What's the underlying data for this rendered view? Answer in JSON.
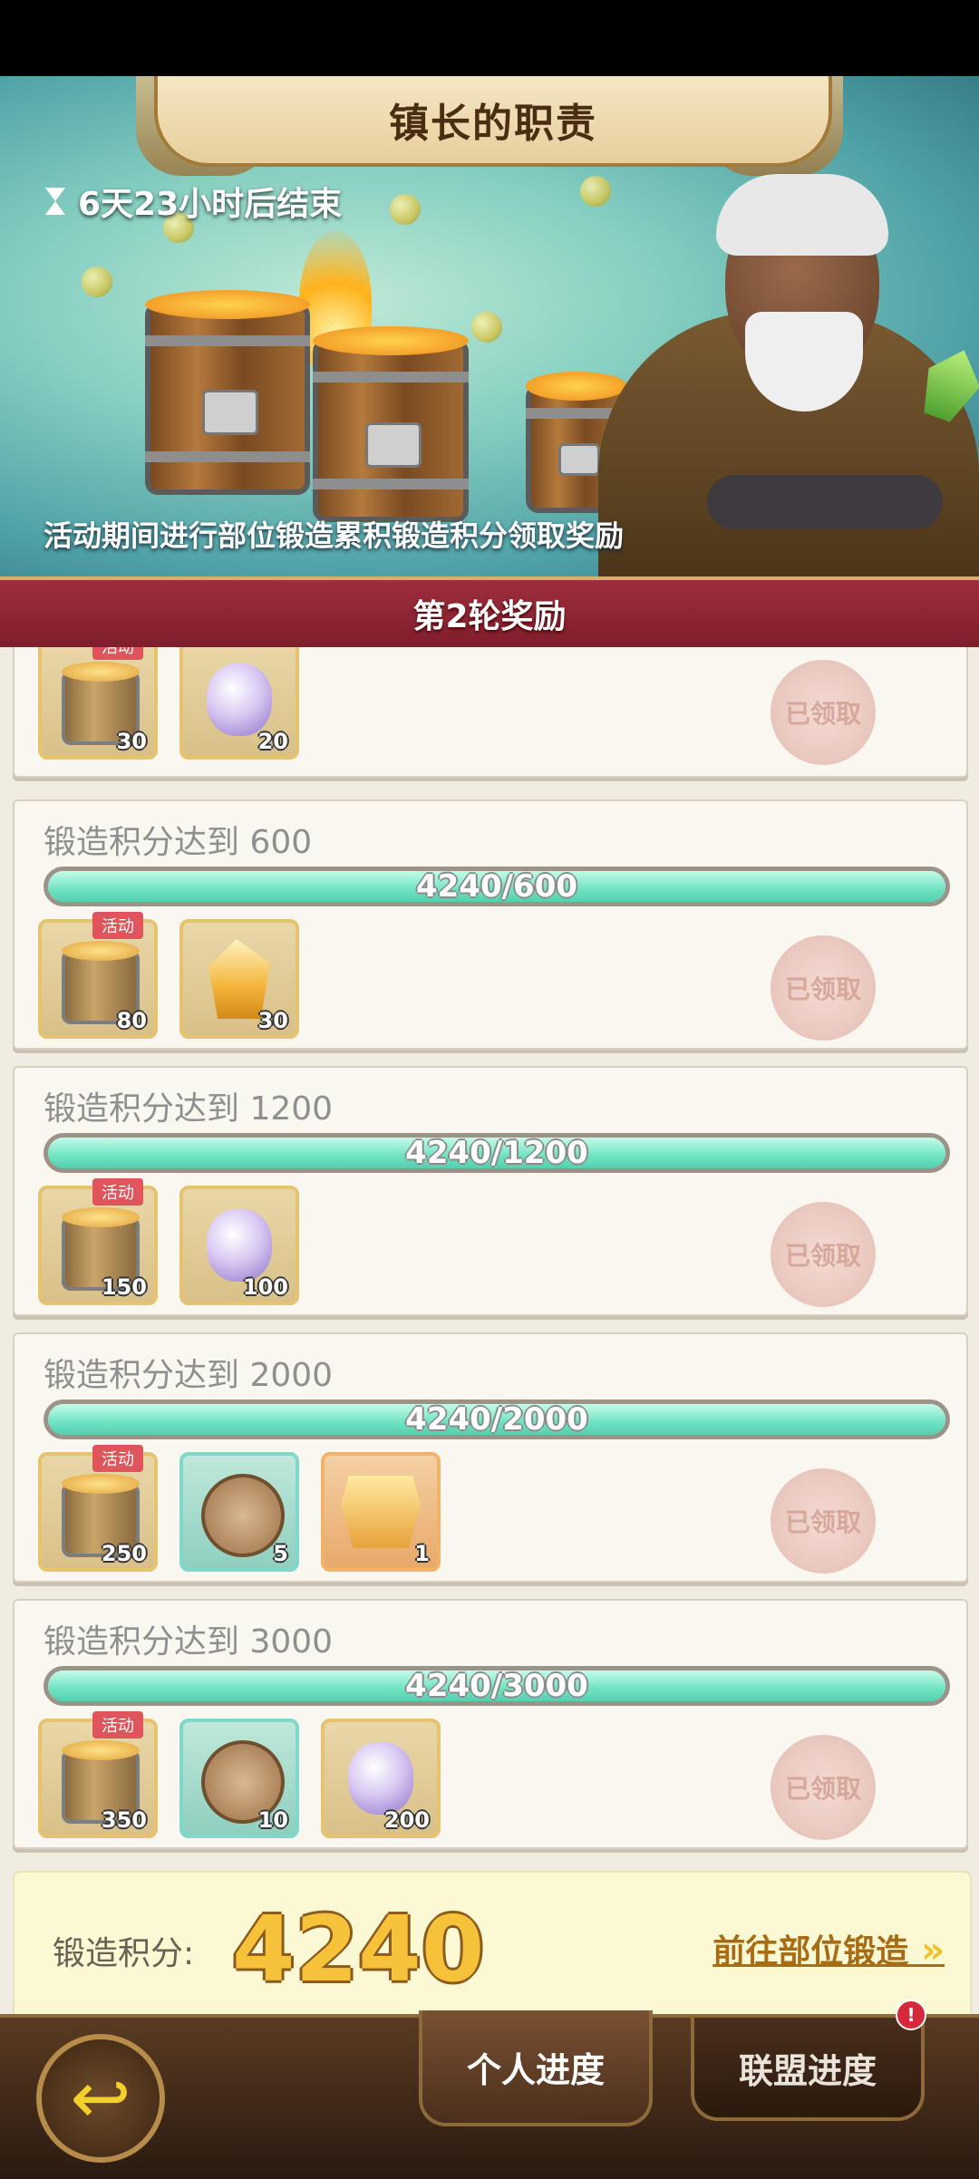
{
  "header": {
    "title": "镇长的职责",
    "timer": "6天23小时后结束",
    "description": "活动期间进行部位锻造累积锻造积分领取奖励"
  },
  "round": {
    "label": "第2轮奖励"
  },
  "top_partial_card": {
    "rewards": [
      {
        "icon": "keg-icon",
        "count": "30",
        "tag": "活动",
        "style": "gold"
      },
      {
        "icon": "purple-orb-icon",
        "count": "20",
        "style": "gold"
      }
    ],
    "claimed_label": "已领取"
  },
  "milestones": [
    {
      "title": "锻造积分达到 600",
      "progress_text": "4240/600",
      "progress": 1.0,
      "claimed_label": "已领取",
      "rewards": [
        {
          "icon": "keg-icon",
          "count": "80",
          "tag": "活动",
          "style": "gold"
        },
        {
          "icon": "amber-crystal-icon",
          "count": "30",
          "style": "gold"
        }
      ]
    },
    {
      "title": "锻造积分达到 1200",
      "progress_text": "4240/1200",
      "progress": 1.0,
      "claimed_label": "已领取",
      "rewards": [
        {
          "icon": "keg-icon",
          "count": "150",
          "tag": "活动",
          "style": "gold"
        },
        {
          "icon": "purple-orb-icon",
          "count": "100",
          "style": "gold"
        }
      ]
    },
    {
      "title": "锻造积分达到 2000",
      "progress_text": "4240/2000",
      "progress": 1.0,
      "claimed_label": "已领取",
      "rewards": [
        {
          "icon": "keg-icon",
          "count": "250",
          "tag": "活动",
          "style": "gold"
        },
        {
          "icon": "dragon-medal-icon",
          "count": "5",
          "style": "teal"
        },
        {
          "icon": "golden-chest-icon",
          "count": "1",
          "style": "orange"
        }
      ]
    },
    {
      "title": "锻造积分达到 3000",
      "progress_text": "4240/3000",
      "progress": 1.0,
      "claimed_label": "已领取",
      "rewards": [
        {
          "icon": "keg-icon",
          "count": "350",
          "tag": "活动",
          "style": "gold"
        },
        {
          "icon": "dragon-medal-icon",
          "count": "10",
          "style": "teal"
        },
        {
          "icon": "purple-orb-icon",
          "count": "200",
          "style": "gold"
        }
      ]
    }
  ],
  "score": {
    "label": "锻造积分:",
    "value": "4240",
    "link": "前往部位锻造"
  },
  "bottom_nav": {
    "tabs": [
      "个人进度",
      "联盟进度"
    ],
    "active_tab": 0,
    "alliance_badge": "!"
  },
  "colors": {
    "progress_fill": "#6ee3c3",
    "round_bar": "#9e2d3c",
    "score_value": "#f5c23a"
  }
}
